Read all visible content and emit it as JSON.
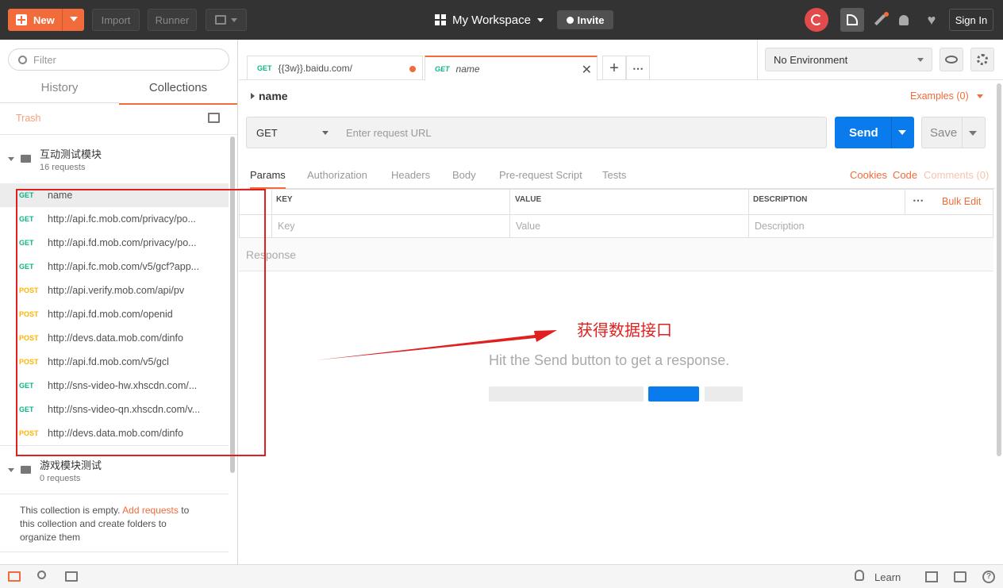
{
  "topbar": {
    "new_label": "New",
    "import_label": "Import",
    "runner_label": "Runner",
    "workspace_label": "My Workspace",
    "invite_label": "Invite",
    "signin_label": "Sign In"
  },
  "sidebar": {
    "filter_placeholder": "Filter",
    "tabs": [
      "History",
      "Collections"
    ],
    "trash_label": "Trash",
    "collections": [
      {
        "name": "互动测试模块",
        "count": "16 requests",
        "requests": [
          {
            "method": "GET",
            "name": "name"
          },
          {
            "method": "GET",
            "name": "http://api.fc.mob.com/privacy/po..."
          },
          {
            "method": "GET",
            "name": "http://api.fd.mob.com/privacy/po..."
          },
          {
            "method": "GET",
            "name": "http://api.fc.mob.com/v5/gcf?app..."
          },
          {
            "method": "POST",
            "name": "http://api.verify.mob.com/api/pv"
          },
          {
            "method": "POST",
            "name": "http://api.fd.mob.com/openid"
          },
          {
            "method": "POST",
            "name": "http://devs.data.mob.com/dinfo"
          },
          {
            "method": "POST",
            "name": "http://api.fd.mob.com/v5/gcl"
          },
          {
            "method": "GET",
            "name": "http://sns-video-hw.xhscdn.com/..."
          },
          {
            "method": "GET",
            "name": "http://sns-video-qn.xhscdn.com/v..."
          },
          {
            "method": "POST",
            "name": "http://devs.data.mob.com/dinfo"
          }
        ]
      },
      {
        "name": "游戏模块测试",
        "count": "0 requests"
      }
    ],
    "empty_text_1": "This collection is empty.",
    "empty_link": "Add requests",
    "empty_text_2": "to",
    "empty_text_3": "this collection and create folders to",
    "empty_text_4": "organize them"
  },
  "tabs": [
    {
      "method": "GET",
      "title": "{{3w}}.baidu.com/"
    },
    {
      "method": "GET",
      "title": "name"
    }
  ],
  "env": {
    "selected": "No Environment"
  },
  "request": {
    "name": "name",
    "examples_label": "Examples (0)",
    "method": "GET",
    "url_placeholder": "Enter request URL",
    "send_label": "Send",
    "save_label": "Save"
  },
  "subtabs": [
    "Params",
    "Authorization",
    "Headers",
    "Body",
    "Pre-request Script",
    "Tests"
  ],
  "right_links": {
    "cookies": "Cookies",
    "code": "Code",
    "comments": "Comments (0)"
  },
  "params_table": {
    "headers": [
      "KEY",
      "VALUE",
      "DESCRIPTION"
    ],
    "bulk_edit": "Bulk Edit",
    "placeholders": [
      "Key",
      "Value",
      "Description"
    ]
  },
  "response": {
    "title": "Response",
    "hint": "Hit the Send button to get a response."
  },
  "annotation": {
    "text": "获得数据接口"
  },
  "bottombar": {
    "learn_label": "Learn"
  },
  "colors": {
    "accent": "#f26b3a",
    "send": "#097bed",
    "get": "#0cb588",
    "post": "#ffb400",
    "annotation": "#e02020"
  }
}
